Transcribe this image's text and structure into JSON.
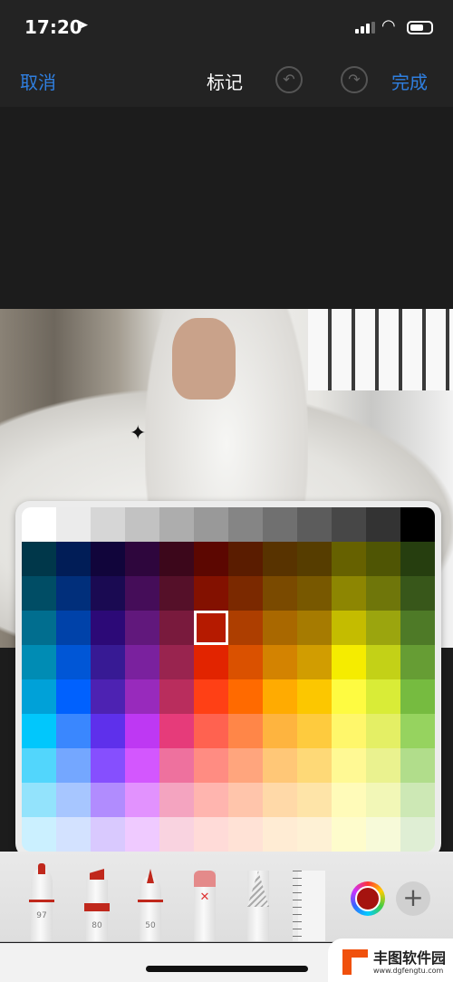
{
  "status_bar": {
    "time": "17:20",
    "location_icon": "location-arrow",
    "wifi_icon": "wifi",
    "battery_level": 0.65
  },
  "nav": {
    "cancel": "取消",
    "title": "标记",
    "undo_icon": "undo",
    "redo_icon": "redo",
    "done": "完成",
    "accent": "#2f7fe0"
  },
  "palette": {
    "selected": {
      "row": 3,
      "col": 5
    },
    "rows": [
      [
        "#ffffff",
        "#ebebeb",
        "#d6d6d6",
        "#c2c2c2",
        "#adadad",
        "#999999",
        "#858585",
        "#707070",
        "#5c5c5c",
        "#474747",
        "#333333",
        "#000000"
      ],
      [
        "#00374a",
        "#011d57",
        "#11053b",
        "#2e063d",
        "#3c071b",
        "#5c0701",
        "#5a1c00",
        "#583300",
        "#563d00",
        "#666100",
        "#4f5504",
        "#263e0f"
      ],
      [
        "#004d65",
        "#012f7b",
        "#1a0a52",
        "#450d59",
        "#551029",
        "#831100",
        "#7b2900",
        "#7a4a00",
        "#785800",
        "#8d8602",
        "#6f760a",
        "#38571a"
      ],
      [
        "#016e8f",
        "#0042a9",
        "#2c0977",
        "#61187c",
        "#791a3d",
        "#b51a00",
        "#ad3e00",
        "#a96800",
        "#a67b01",
        "#c4bc00",
        "#9ba50e",
        "#4e7a27"
      ],
      [
        "#008cb4",
        "#0056d6",
        "#371a94",
        "#7a219e",
        "#99244f",
        "#e22400",
        "#da5100",
        "#d38301",
        "#d19d01",
        "#f5ec00",
        "#c3d117",
        "#669d34"
      ],
      [
        "#00a1d8",
        "#0061fe",
        "#4d22b2",
        "#982abc",
        "#b92d5d",
        "#ff4015",
        "#ff6a00",
        "#ffab01",
        "#fcc700",
        "#fefb41",
        "#d9ec37",
        "#76bb40"
      ],
      [
        "#01c7fc",
        "#3a87fe",
        "#5e30eb",
        "#be38f3",
        "#e63b7a",
        "#ff6250",
        "#ff8648",
        "#feb43f",
        "#fecb3e",
        "#fff76b",
        "#e4ef65",
        "#96d35f"
      ],
      [
        "#52d6fc",
        "#74a7ff",
        "#864ffe",
        "#d357fe",
        "#ee719e",
        "#ff8c82",
        "#ffa57d",
        "#ffc777",
        "#fed977",
        "#fff994",
        "#eaf28f",
        "#b1dd8b"
      ],
      [
        "#93e3fc",
        "#a7c6ff",
        "#b18cfe",
        "#e292fe",
        "#f4a4c0",
        "#ffb5af",
        "#ffc5ab",
        "#ffd9a8",
        "#fee4a8",
        "#fffbb9",
        "#f2f7b7",
        "#cde8b5"
      ],
      [
        "#cbf0ff",
        "#d3e2ff",
        "#d9c9fe",
        "#efcaff",
        "#f9d3e0",
        "#ffdbd8",
        "#ffe2d6",
        "#ffecd4",
        "#fef1d5",
        "#fefccc",
        "#f7fad9",
        "#dfeed4"
      ]
    ]
  },
  "tools": {
    "pen_value": "97",
    "marker_value": "80",
    "pencil_value": "50",
    "current_color": "#a5130f"
  },
  "watermark": {
    "name": "丰图软件园",
    "url": "www.dgfengtu.com"
  }
}
